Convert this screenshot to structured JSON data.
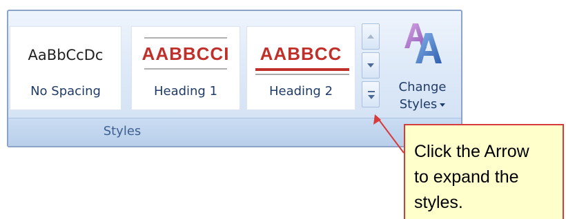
{
  "ribbon": {
    "group_label": "Styles",
    "styles": [
      {
        "preview": "AaBbCcDc",
        "name": "No Spacing"
      },
      {
        "preview": "AABBCCI",
        "name": "Heading 1"
      },
      {
        "preview": "AABBCC",
        "name": "Heading 2"
      }
    ],
    "scroll": {
      "up_icon": "scroll-up-icon",
      "down_icon": "scroll-down-icon",
      "more_icon": "gallery-more-icon"
    },
    "change_styles": {
      "line1": "Change",
      "line2": "Styles",
      "icon": "change-styles-icon"
    }
  },
  "callout": {
    "lines": [
      "Click the Arrow",
      "to expand the",
      "styles."
    ]
  },
  "colors": {
    "heading_red": "#c0302b",
    "ribbon_border": "#8aa3c6",
    "callout_fill": "#ffffcc",
    "callout_border": "#d73a3a"
  }
}
